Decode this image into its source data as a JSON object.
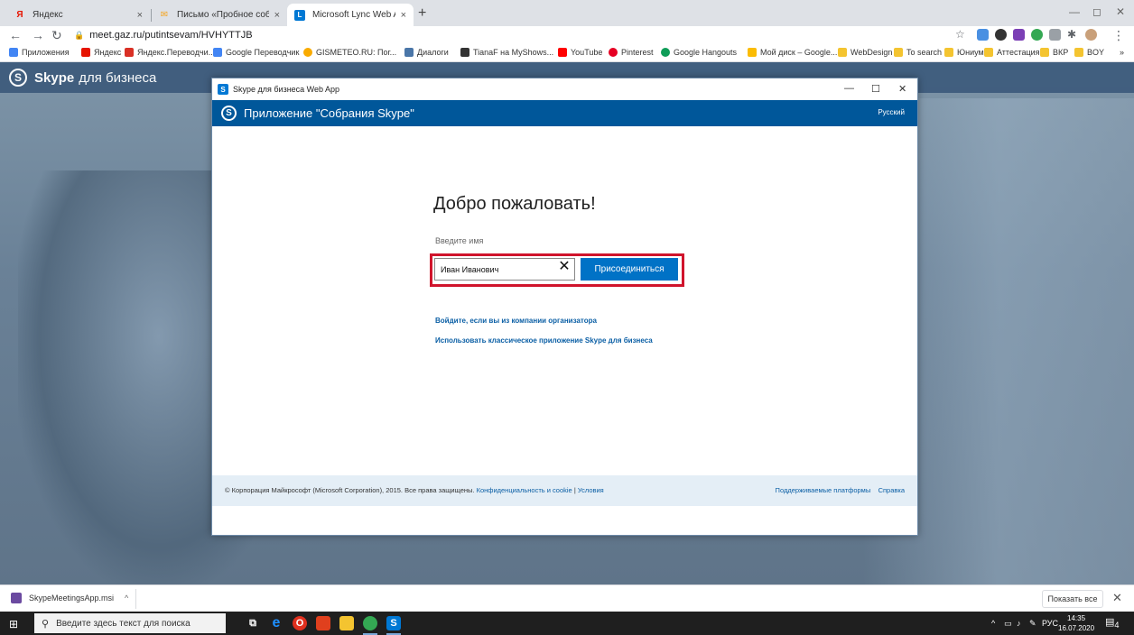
{
  "browser": {
    "tabs": [
      {
        "icon": "yandex-icon",
        "title": "Яндекс",
        "close": "×"
      },
      {
        "icon": "mail-icon",
        "title": "Письмо «Пробное собрание» — ",
        "close": "×"
      },
      {
        "icon": "lync-icon",
        "title": "Microsoft Lync Web App",
        "close": "×"
      }
    ],
    "new_tab": "+",
    "window_controls": {
      "minimize": "—",
      "restore": "◻",
      "close": "✕"
    },
    "url": "meet.gaz.ru/putintsevam/HVHYTTJB",
    "bookmarks": [
      "Приложения",
      "Яндекс",
      "Яндекс.Переводчи...",
      "Google Переводчик",
      "GISMETEO.RU: Пог...",
      "Диалоги",
      "TianaF на MyShows...",
      "YouTube",
      "Pinterest",
      "Google Hangouts",
      "Мой диск – Google...",
      "WebDesign",
      "To search",
      "Юниум",
      "Аттестация",
      "ВКР",
      "BOY"
    ],
    "bookmarks_more": "»"
  },
  "page": {
    "brand_bold": "Skype",
    "brand_rest": "для бизнеса"
  },
  "dialog": {
    "window_title": "Skype для бизнеса Web App",
    "controls": {
      "minimize": "—",
      "maximize": "☐",
      "close": "✕"
    },
    "header_title": "Приложение \"Собрания Skype\"",
    "language": "Русский",
    "welcome": "Добро пожаловать!",
    "name_label": "Введите имя",
    "name_value": "Иван Иванович",
    "clear": "✕",
    "join_button": "Присоединиться",
    "link_signin": "Войдите, если вы из компании организатора",
    "link_classic": "Использовать классическое приложение Skype для бизнеса",
    "footer": {
      "copyright": "© Корпорация Майкрософт (Microsoft Corporation), 2015. Все права защищены.",
      "privacy": "Конфиденциальность и cookie",
      "separator": "|",
      "terms": "Условия",
      "platforms": "Поддерживаемые платформы",
      "help": "Справка"
    }
  },
  "download_bar": {
    "file": "SkypeMeetingsApp.msi",
    "chevron": "^",
    "show_all": "Показать все",
    "close": "✕"
  },
  "taskbar": {
    "search_placeholder": "Введите здесь текст для поиска",
    "language": "РУС",
    "time": "14:35",
    "date": "16.07.2020",
    "notifications": "4"
  },
  "colors": {
    "skype_blue": "#00579a",
    "join_blue": "#0072c6",
    "highlight_red": "#d0142c",
    "link_blue": "#0b5fa5"
  }
}
